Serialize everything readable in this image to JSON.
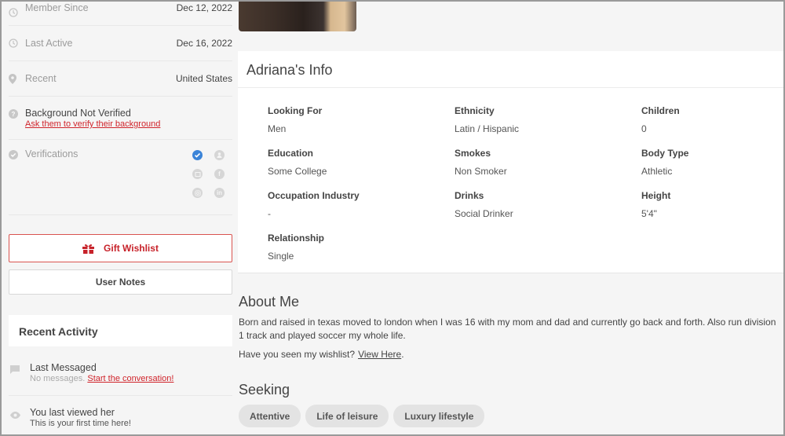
{
  "sidebar": {
    "stats": [
      {
        "icon": "clock-icon",
        "label": "Member Since",
        "value": "Dec 12, 2022"
      },
      {
        "icon": "clock-icon",
        "label": "Last Active",
        "value": "Dec 16, 2022"
      },
      {
        "icon": "location-pin-icon",
        "label": "Recent",
        "value": "United States"
      }
    ],
    "background": {
      "title": "Background Not Verified",
      "link": "Ask them to verify their background"
    },
    "verifications": {
      "label": "Verifications",
      "icons": [
        {
          "name": "verified-check-icon",
          "active": true
        },
        {
          "name": "profile-icon",
          "active": false
        },
        {
          "name": "photo-icon",
          "active": false
        },
        {
          "name": "facebook-icon",
          "active": false
        },
        {
          "name": "instagram-icon",
          "active": false
        },
        {
          "name": "linkedin-icon",
          "active": false
        }
      ]
    },
    "buttons": {
      "gift_wishlist": "Gift Wishlist",
      "user_notes": "User Notes"
    },
    "recent_activity": {
      "title": "Recent Activity",
      "items": [
        {
          "icon": "message-icon",
          "title": "Last Messaged",
          "sub": "No messages.",
          "link": "Start the conversation!"
        },
        {
          "icon": "eye-icon",
          "title": "You last viewed her",
          "sub": "This is your first time here!"
        }
      ]
    }
  },
  "info": {
    "title": "Adriana's Info",
    "fields": [
      {
        "key": "Looking For",
        "value": "Men"
      },
      {
        "key": "Ethnicity",
        "value": "Latin / Hispanic"
      },
      {
        "key": "Children",
        "value": "0"
      },
      {
        "key": "Education",
        "value": "Some College"
      },
      {
        "key": "Smokes",
        "value": "Non Smoker"
      },
      {
        "key": "Body Type",
        "value": "Athletic"
      },
      {
        "key": "Occupation Industry",
        "value": "-"
      },
      {
        "key": "Drinks",
        "value": "Social Drinker"
      },
      {
        "key": "Height",
        "value": "5'4\""
      },
      {
        "key": "Relationship",
        "value": "Single"
      }
    ]
  },
  "about": {
    "title": "About Me",
    "text": "Born and raised in texas moved to london when I was 16 with my mom and dad and currently go back and forth. Also run division 1 track and played soccer my whole life.",
    "wishlist_prompt": "Have you seen my wishlist?",
    "wishlist_link": "View Here",
    "wishlist_suffix": "."
  },
  "seeking": {
    "title": "Seeking",
    "tags": [
      "Attentive",
      "Life of leisure",
      "Luxury lifestyle"
    ]
  },
  "colors": {
    "accent_red": "#c7222a",
    "verified_blue": "#3b84d8"
  }
}
